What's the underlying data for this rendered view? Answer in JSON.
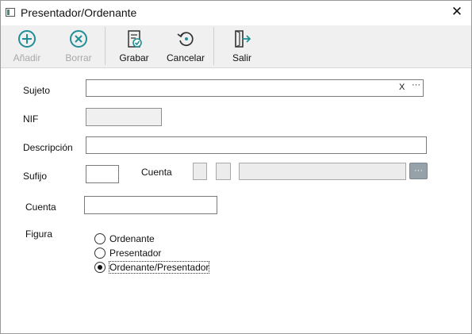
{
  "window": {
    "title": "Presentador/Ordenante",
    "close_glyph": "✕"
  },
  "toolbar": {
    "add_label": "Añadir",
    "delete_label": "Borrar",
    "save_label": "Grabar",
    "cancel_label": "Cancelar",
    "exit_label": "Salir",
    "add_enabled": false,
    "delete_enabled": false,
    "icons": {
      "add": "plus-circle-icon",
      "delete": "x-circle-icon",
      "save": "document-check-icon",
      "cancel": "undo-icon",
      "exit": "exit-door-icon"
    },
    "icon_color": "#1e8f95"
  },
  "form": {
    "sujeto": {
      "label": "Sujeto",
      "value": "",
      "clear_glyph": "X",
      "more_glyph": "···"
    },
    "nif": {
      "label": "NIF",
      "value": ""
    },
    "descripcion": {
      "label": "Descripción",
      "value": ""
    },
    "sufijo": {
      "label": "Sufijo",
      "value": ""
    },
    "cuenta_banco": {
      "label": "Cuenta",
      "part1": "",
      "part2": "",
      "part3": "",
      "more_glyph": "···"
    },
    "cuenta": {
      "label": "Cuenta",
      "value": ""
    },
    "figura": {
      "label": "Figura",
      "options": [
        "Ordenante",
        "Presentador",
        "Ordenante/Presentador"
      ],
      "selected": "Ordenante/Presentador"
    }
  }
}
